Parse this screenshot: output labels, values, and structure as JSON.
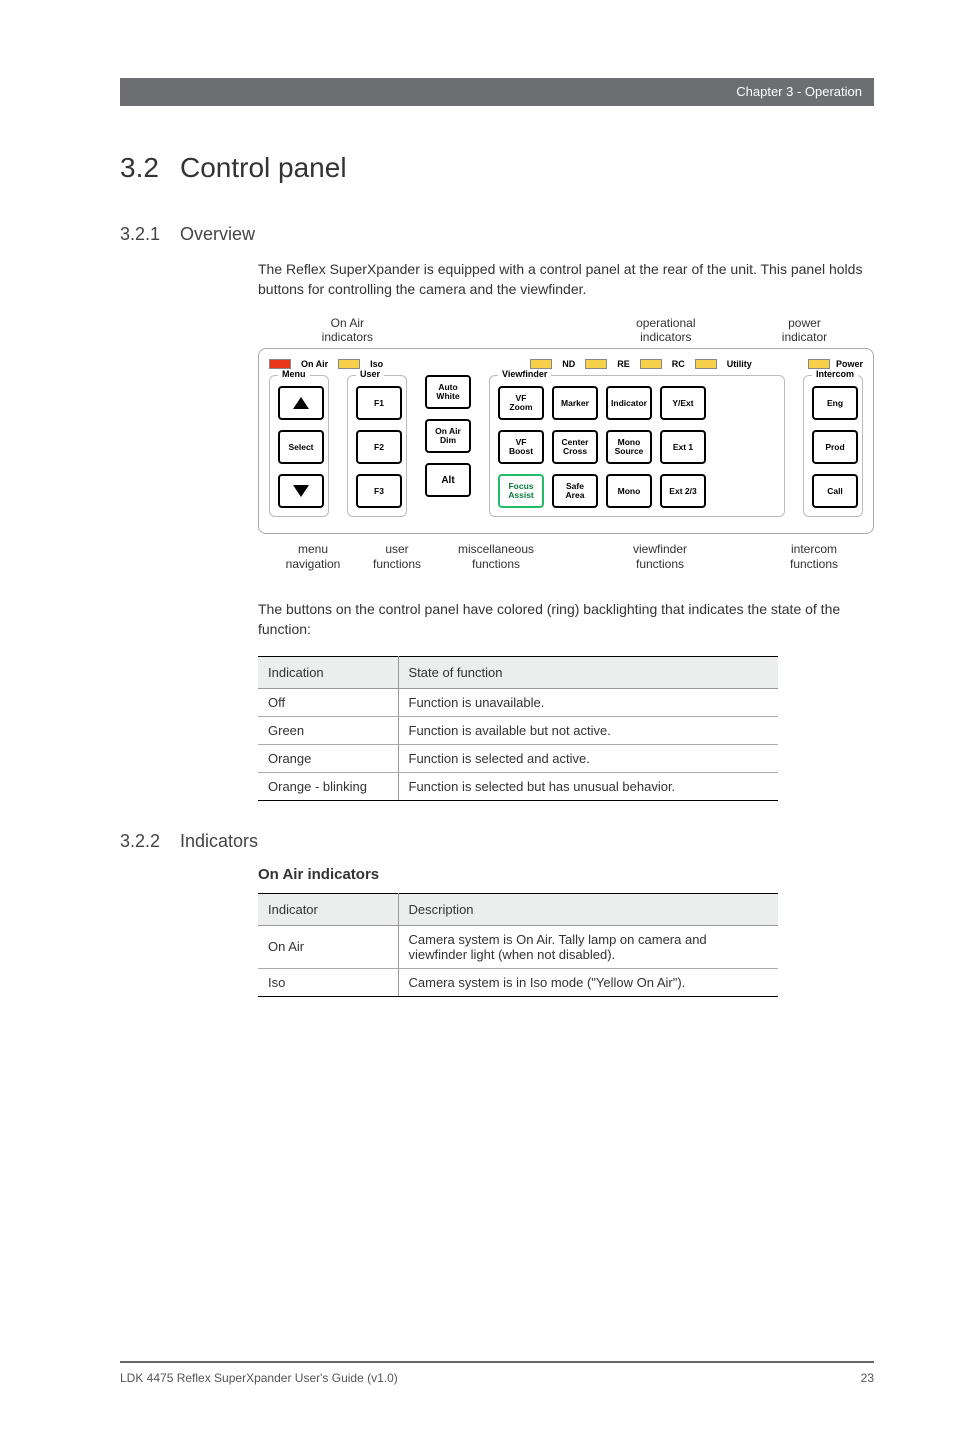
{
  "header": {
    "chapter": "Chapter 3 - Operation"
  },
  "section": {
    "number": "3.2",
    "title": "Control panel"
  },
  "overview": {
    "number": "3.2.1",
    "title": "Overview",
    "intro": "The Reflex SuperXpander is equipped with a control panel at the rear of the unit. This panel holds buttons for controlling the camera and the viewfinder.",
    "after_diagram": "The buttons on the control panel have colored (ring) backlighting that indicates the state of the function:"
  },
  "diagram": {
    "top_labels": {
      "onair": {
        "l1": "On Air",
        "l2": "indicators"
      },
      "oper": {
        "l1": "operational",
        "l2": "indicators"
      },
      "power": {
        "l1": "power",
        "l2": "indicator"
      }
    },
    "indicators": {
      "on_air": "On Air",
      "iso": "Iso",
      "nd": "ND",
      "re": "RE",
      "rc": "RC",
      "utility": "Utility",
      "power": "Power"
    },
    "legends": {
      "menu": "Menu",
      "user": "User",
      "viewfinder": "Viewfinder",
      "intercom": "Intercom"
    },
    "buttons": {
      "menu": {
        "select": "Select"
      },
      "user": {
        "f1": "F1",
        "f2": "F2",
        "f3": "F3"
      },
      "misc": {
        "auto_white": "Auto\nWhite",
        "onair_dim": "On Air\nDim",
        "alt": "Alt"
      },
      "viewfinder": {
        "vf_zoom": "VF\nZoom",
        "marker": "Marker",
        "indicator": "Indicator",
        "y_ext": "Y/Ext",
        "vf_boost": "VF\nBoost",
        "center_cross": "Center\nCross",
        "mono_source": "Mono\nSource",
        "ext1": "Ext 1",
        "focus_assist": "Focus\nAssist",
        "safe_area": "Safe\nArea",
        "mono": "Mono",
        "ext23": "Ext 2/3"
      },
      "intercom": {
        "eng": "Eng",
        "prod": "Prod",
        "call": "Call"
      }
    },
    "bottom_labels": {
      "menu": {
        "l1": "menu",
        "l2": "navigation"
      },
      "user": {
        "l1": "user",
        "l2": "functions"
      },
      "misc": {
        "l1": "miscellaneous",
        "l2": "functions"
      },
      "vf": {
        "l1": "viewfinder",
        "l2": "functions"
      },
      "ic": {
        "l1": "intercom",
        "l2": "functions"
      }
    }
  },
  "state_table": {
    "headers": {
      "indication": "Indication",
      "state": "State of function"
    },
    "rows": [
      {
        "ind": "Off",
        "state": "Function is unavailable."
      },
      {
        "ind": "Green",
        "state": "Function is available but not active."
      },
      {
        "ind": "Orange",
        "state": "Function is selected and active."
      },
      {
        "ind": "Orange - blinking",
        "state": "Function is selected but has unusual behavior."
      }
    ]
  },
  "indicators_section": {
    "number": "3.2.2",
    "title": "Indicators",
    "subhead": "On Air indicators",
    "headers": {
      "indicator": "Indicator",
      "desc": "Description"
    },
    "rows": [
      {
        "ind": "On Air",
        "desc": "Camera system is On Air. Tally lamp on camera and viewfinder light (when not disabled)."
      },
      {
        "ind": "Iso",
        "desc": "Camera system is in Iso mode (\"Yellow On Air\")."
      }
    ]
  },
  "footer": {
    "left": "LDK 4475 Reflex SuperXpander User's Guide (v1.0)",
    "right": "23"
  }
}
